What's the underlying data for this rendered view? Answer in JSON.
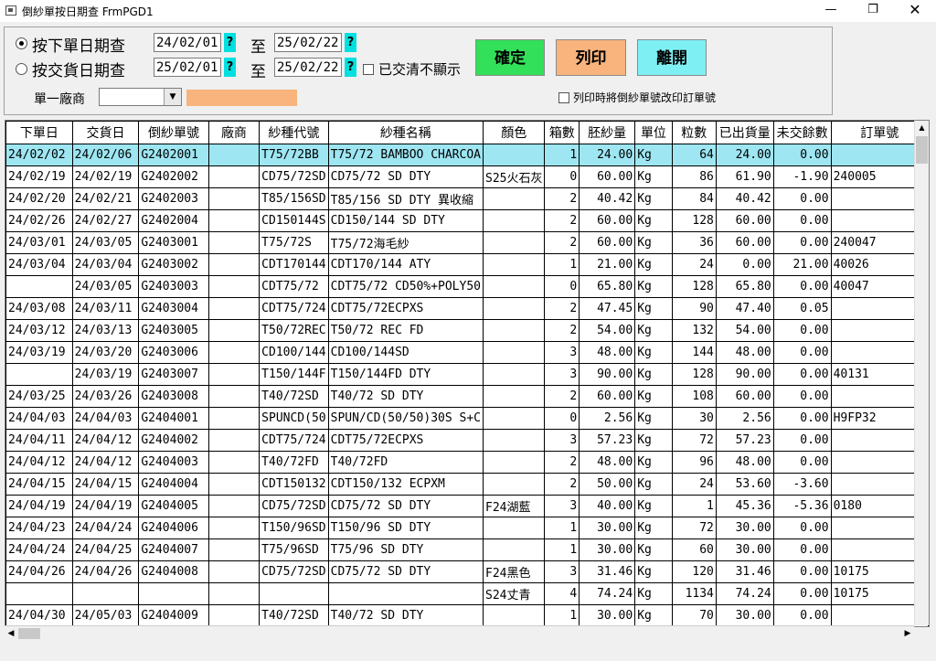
{
  "window": {
    "title": "倒紗單按日期查 FrmPGD1"
  },
  "filter": {
    "radio_order_label": "按下單日期查",
    "radio_delivery_label": "按交貨日期查",
    "to_label": "至",
    "order_from": "24/02/01",
    "order_to": "25/02/22",
    "delivery_from": "25/02/01",
    "delivery_to": "25/02/22",
    "q": "?",
    "hide_closed_label": "已交清不顯示",
    "vendor_label": "單一廠商",
    "print_option_label": "列印時將倒紗單號改印訂單號"
  },
  "buttons": {
    "confirm": "確定",
    "print": "列印",
    "exit": "離開"
  },
  "grid": {
    "headers": [
      "下單日",
      "交貨日",
      "倒紗單號",
      "廠商",
      "紗種代號",
      "紗種名稱",
      "顏色",
      "箱數",
      "胚紗量",
      "單位",
      "粒數",
      "已出貨量",
      "未交餘數",
      "訂單號"
    ],
    "rows": [
      [
        "24/02/02",
        "24/02/06",
        "G2402001",
        "",
        "T75/72BB",
        "T75/72 BAMBOO CHARCOA",
        "",
        "1",
        "24.00",
        "Kg",
        "64",
        "24.00",
        "0.00",
        ""
      ],
      [
        "24/02/19",
        "24/02/19",
        "G2402002",
        "",
        "CD75/72SD",
        "CD75/72 SD DTY",
        "S25火石灰",
        "0",
        "60.00",
        "Kg",
        "86",
        "61.90",
        "-1.90",
        "240005"
      ],
      [
        "24/02/20",
        "24/02/21",
        "G2402003",
        "",
        "T85/156SD",
        "T85/156 SD DTY 異收縮",
        "",
        "2",
        "40.42",
        "Kg",
        "84",
        "40.42",
        "0.00",
        ""
      ],
      [
        "24/02/26",
        "24/02/27",
        "G2402004",
        "",
        "CD150144S",
        "CD150/144 SD DTY",
        "",
        "2",
        "60.00",
        "Kg",
        "128",
        "60.00",
        "0.00",
        ""
      ],
      [
        "24/03/01",
        "24/03/05",
        "G2403001",
        "",
        "T75/72S",
        "T75/72海毛紗",
        "",
        "2",
        "60.00",
        "Kg",
        "36",
        "60.00",
        "0.00",
        "240047"
      ],
      [
        "24/03/04",
        "24/03/04",
        "G2403002",
        "",
        "CDT170144",
        "CDT170/144 ATY",
        "",
        "1",
        "21.00",
        "Kg",
        "24",
        "0.00",
        "21.00",
        "40026"
      ],
      [
        "",
        "24/03/05",
        "G2403003",
        "",
        "CDT75/72",
        "CDT75/72 CD50%+POLY50",
        "",
        "0",
        "65.80",
        "Kg",
        "128",
        "65.80",
        "0.00",
        "40047"
      ],
      [
        "24/03/08",
        "24/03/11",
        "G2403004",
        "",
        "CDT75/724",
        "CDT75/72ECPXS",
        "",
        "2",
        "47.45",
        "Kg",
        "90",
        "47.40",
        "0.05",
        ""
      ],
      [
        "24/03/12",
        "24/03/13",
        "G2403005",
        "",
        "T50/72REC",
        "T50/72 REC FD",
        "",
        "2",
        "54.00",
        "Kg",
        "132",
        "54.00",
        "0.00",
        ""
      ],
      [
        "24/03/19",
        "24/03/20",
        "G2403006",
        "",
        "CD100/144",
        "CD100/144SD",
        "",
        "3",
        "48.00",
        "Kg",
        "144",
        "48.00",
        "0.00",
        ""
      ],
      [
        "",
        "24/03/19",
        "G2403007",
        "",
        "T150/144F",
        "T150/144FD DTY",
        "",
        "3",
        "90.00",
        "Kg",
        "128",
        "90.00",
        "0.00",
        "40131"
      ],
      [
        "24/03/25",
        "24/03/26",
        "G2403008",
        "",
        "T40/72SD",
        "T40/72 SD DTY",
        "",
        "2",
        "60.00",
        "Kg",
        "108",
        "60.00",
        "0.00",
        ""
      ],
      [
        "24/04/03",
        "24/04/03",
        "G2404001",
        "",
        "SPUNCD(50",
        "SPUN/CD(50/50)30S S+C",
        "",
        "0",
        "2.56",
        "Kg",
        "30",
        "2.56",
        "0.00",
        "H9FP32"
      ],
      [
        "24/04/11",
        "24/04/12",
        "G2404002",
        "",
        "CDT75/724",
        "CDT75/72ECPXS",
        "",
        "3",
        "57.23",
        "Kg",
        "72",
        "57.23",
        "0.00",
        ""
      ],
      [
        "24/04/12",
        "24/04/12",
        "G2404003",
        "",
        "T40/72FD",
        "T40/72FD",
        "",
        "2",
        "48.00",
        "Kg",
        "96",
        "48.00",
        "0.00",
        ""
      ],
      [
        "24/04/15",
        "24/04/15",
        "G2404004",
        "",
        "CDT150132",
        "CDT150/132 ECPXM",
        "",
        "2",
        "50.00",
        "Kg",
        "24",
        "53.60",
        "-3.60",
        ""
      ],
      [
        "24/04/19",
        "24/04/19",
        "G2404005",
        "",
        "CD75/72SD",
        "CD75/72 SD DTY",
        "F24湖藍",
        "3",
        "40.00",
        "Kg",
        "1",
        "45.36",
        "-5.36",
        "0180"
      ],
      [
        "24/04/23",
        "24/04/24",
        "G2404006",
        "",
        "T150/96SD",
        "T150/96 SD DTY",
        "",
        "1",
        "30.00",
        "Kg",
        "72",
        "30.00",
        "0.00",
        ""
      ],
      [
        "24/04/24",
        "24/04/25",
        "G2404007",
        "",
        "T75/96SD",
        "T75/96 SD DTY",
        "",
        "1",
        "30.00",
        "Kg",
        "60",
        "30.00",
        "0.00",
        ""
      ],
      [
        "24/04/26",
        "24/04/26",
        "G2404008",
        "",
        "CD75/72SD",
        "CD75/72 SD DTY",
        "F24黑色",
        "3",
        "31.46",
        "Kg",
        "120",
        "31.46",
        "0.00",
        "10175"
      ],
      [
        "",
        "",
        "",
        "",
        "",
        "",
        "S24丈青",
        "4",
        "74.24",
        "Kg",
        "1134",
        "74.24",
        "0.00",
        "10175"
      ],
      [
        "24/04/30",
        "24/05/03",
        "G2404009",
        "",
        "T40/72SD",
        "T40/72 SD DTY",
        "",
        "1",
        "30.00",
        "Kg",
        "70",
        "30.00",
        "0.00",
        ""
      ]
    ]
  },
  "colors": {
    "selected_row": "#9de6f2",
    "confirm_btn": "#33e05a",
    "print_btn": "#f8b47c",
    "exit_btn": "#7ef0f4",
    "qbtn": "#00e0e0"
  }
}
